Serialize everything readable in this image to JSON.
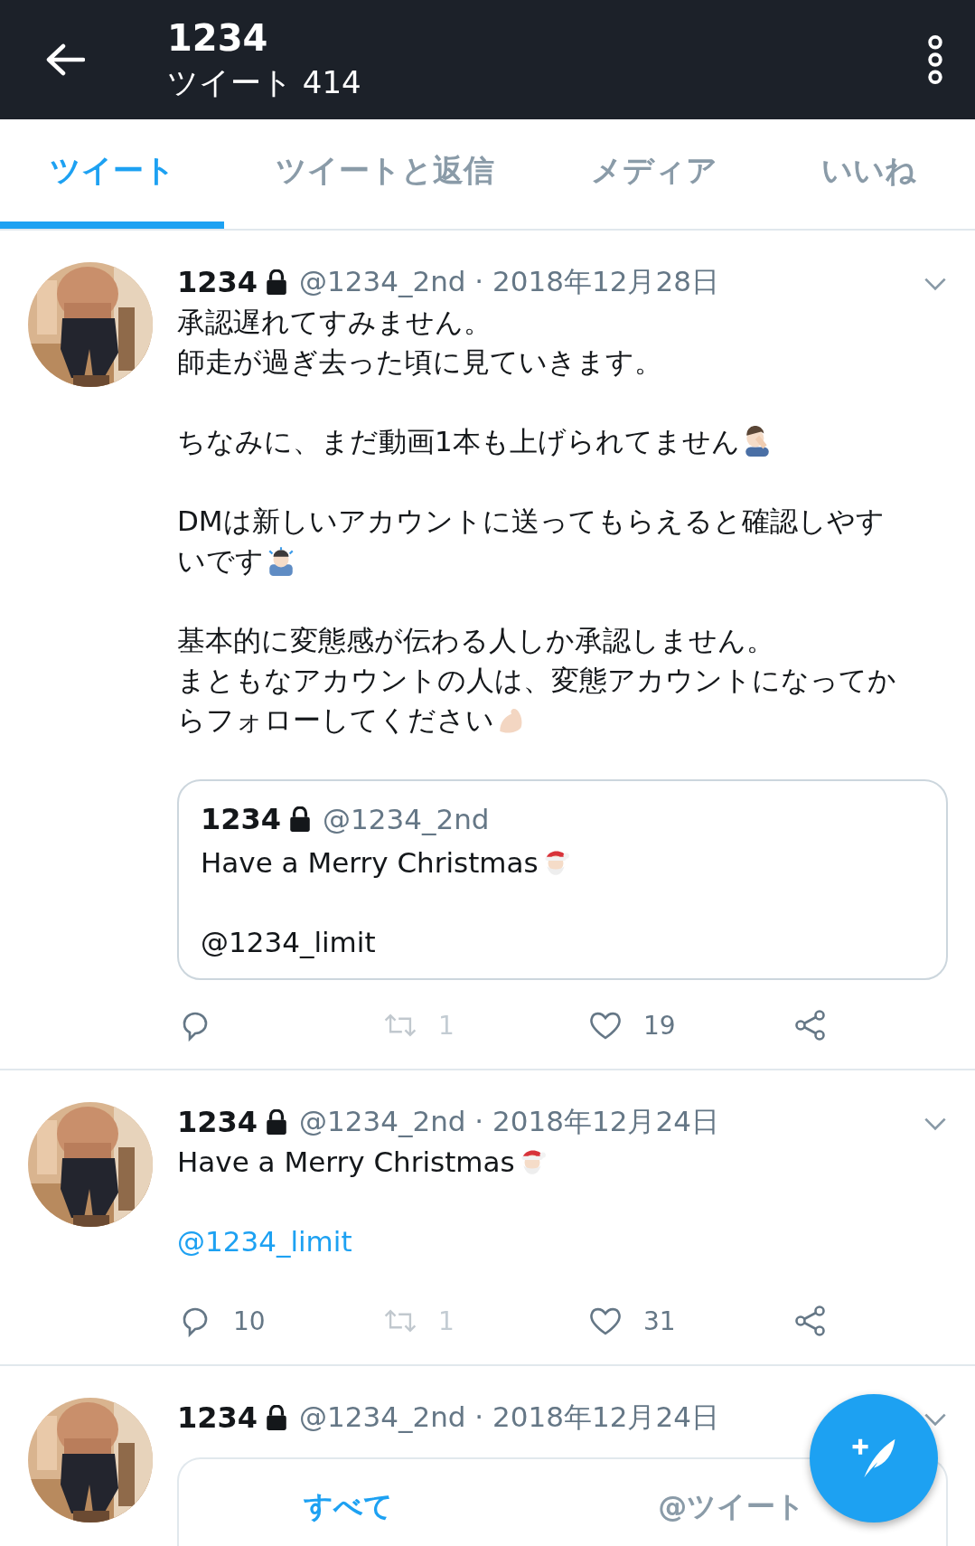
{
  "header": {
    "title": "1234",
    "subtitle": "ツイート 414"
  },
  "tabs": [
    {
      "label": "ツイート",
      "selected": true
    },
    {
      "label": "ツイートと返信",
      "selected": false
    },
    {
      "label": "メディア",
      "selected": false
    },
    {
      "label": "いいね",
      "selected": false
    }
  ],
  "tweets": [
    {
      "name": "1234",
      "protected": true,
      "handle": "@1234_2nd · 2018年12月28日",
      "body": [
        {
          "kind": "plain",
          "lines": [
            "承認遅れてすみません。",
            "師走が過ぎ去った頃に見ていきます。"
          ]
        },
        {
          "kind": "facepalm",
          "lines": [
            "ちなみに、まだ動画1本も上げられてません"
          ]
        },
        {
          "kind": "bow",
          "lines": [
            "DMは新しいアカウントに送ってもらえると確認しやす",
            "いです"
          ]
        },
        {
          "kind": "muscle",
          "lines": [
            "基本的に変態感が伝わる人しか承認しません。",
            "まともなアカウントの人は、変態アカウントになってか",
            "らフォローしてください"
          ]
        }
      ],
      "quote": {
        "name": "1234",
        "protected": true,
        "handle": "@1234_2nd",
        "body": [
          {
            "kind": "santa",
            "lines": [
              "Have a Merry Christmas"
            ]
          },
          {
            "kind": "plain",
            "lines": [
              "@1234_limit"
            ]
          }
        ]
      },
      "actions": [
        {
          "kind": "reply"
        },
        {
          "kind": "retweet",
          "count": "1",
          "disabled": true
        },
        {
          "kind": "like",
          "count": "19"
        },
        {
          "kind": "share"
        }
      ]
    },
    {
      "name": "1234",
      "protected": true,
      "handle": "@1234_2nd · 2018年12月24日",
      "body": [
        {
          "kind": "santa",
          "lines": [
            "Have a Merry Christmas"
          ]
        },
        {
          "kind": "link",
          "lines": [
            "@1234_limit"
          ]
        }
      ],
      "actions": [
        {
          "kind": "reply",
          "count": "10"
        },
        {
          "kind": "retweet",
          "count": "1",
          "disabled": true
        },
        {
          "kind": "like",
          "count": "31"
        },
        {
          "kind": "share"
        }
      ]
    },
    {
      "name": "1234",
      "protected": true,
      "handle": "@1234_2nd · 2018年12月24日",
      "card_tabs": [
        {
          "label": "すべて",
          "selected": true
        },
        {
          "label": "@ツイート",
          "selected": false
        }
      ]
    }
  ]
}
